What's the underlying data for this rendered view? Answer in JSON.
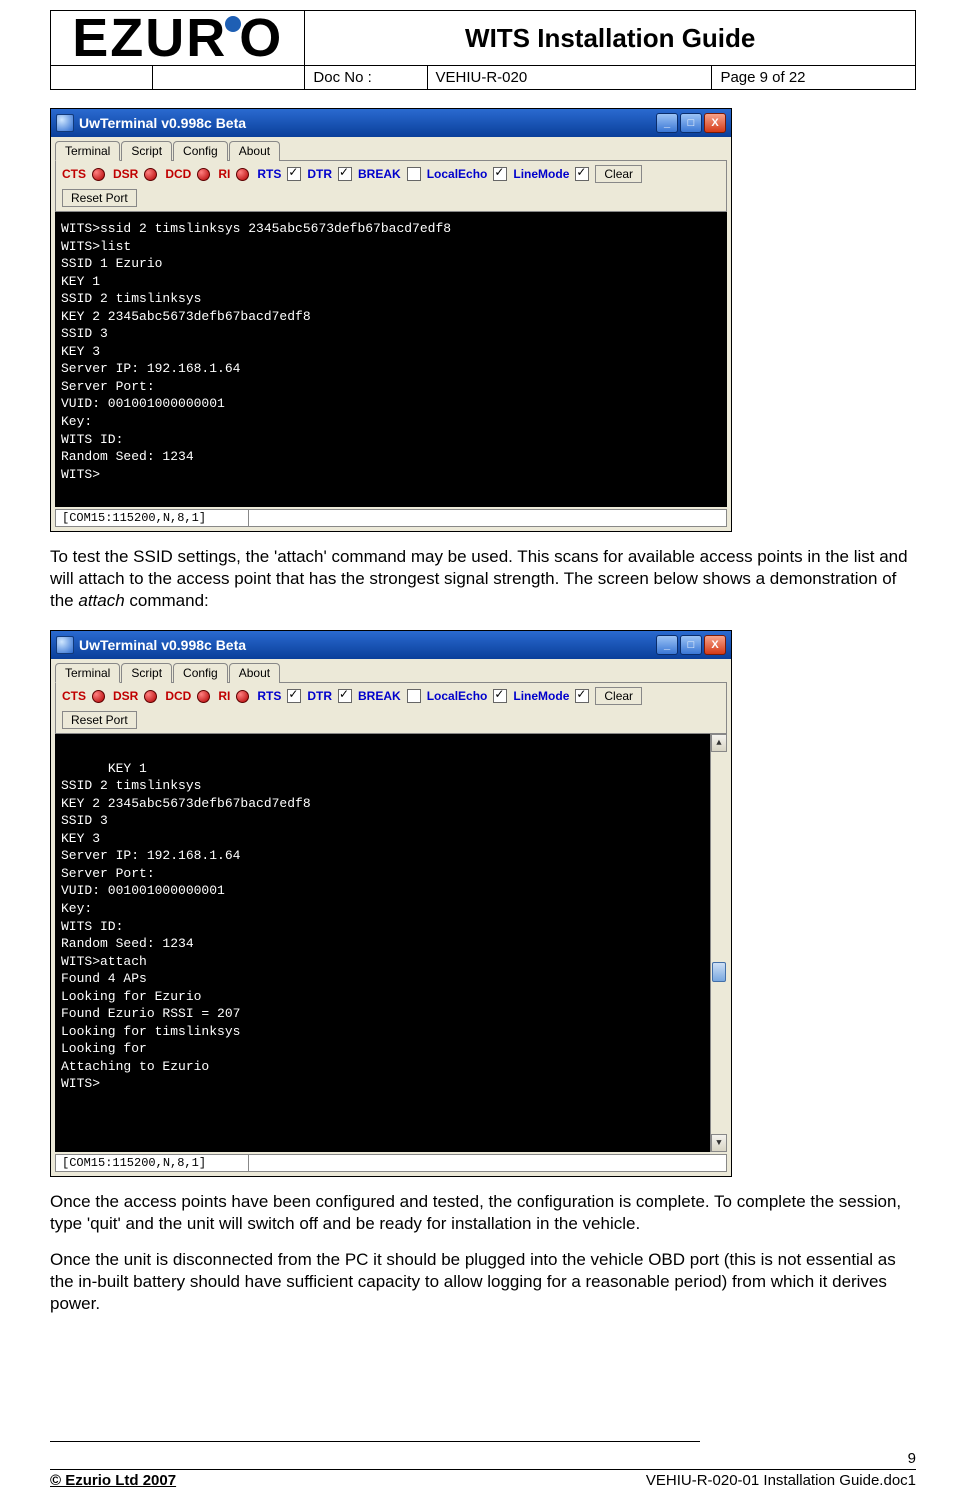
{
  "header": {
    "logo_text": "EZURiO",
    "title": "WITS Installation Guide",
    "doc_no_label": "Doc No :",
    "doc_no_value": "VEHIU-R-020",
    "page_info": "Page 9 of 22"
  },
  "terminal_common": {
    "window_title": "UwTerminal v0.998c Beta",
    "tabs": [
      "Terminal",
      "Script",
      "Config",
      "About"
    ],
    "leds": {
      "cts": "CTS",
      "dsr": "DSR",
      "dcd": "DCD",
      "ri": "RI",
      "rts": "RTS",
      "dtr": "DTR",
      "break": "BREAK",
      "localecho": "LocalEcho",
      "linemode": "LineMode"
    },
    "buttons": {
      "clear": "Clear",
      "reset": "Reset Port"
    },
    "status": "[COM15:115200,N,8,1]"
  },
  "terminal1_lines": [
    "WITS>ssid 2 timslinksys 2345abc5673defb67bacd7edf8",
    "WITS>list",
    "SSID 1 Ezurio",
    "KEY 1",
    "SSID 2 timslinksys",
    "KEY 2 2345abc5673defb67bacd7edf8",
    "SSID 3",
    "KEY 3",
    "Server IP: 192.168.1.64",
    "Server Port:",
    "VUID: 001001000000001",
    "Key:",
    "WITS ID:",
    "Random Seed: 1234",
    "WITS>"
  ],
  "para1": "To test the SSID settings, the 'attach' command may be used. This scans for available access points in the list and will attach to the access point that has the strongest signal strength. The screen below shows a demonstration of the ",
  "para1_em": "attach",
  "para1_tail": " command:",
  "terminal2_lines": [
    "KEY 1",
    "SSID 2 timslinksys",
    "KEY 2 2345abc5673defb67bacd7edf8",
    "SSID 3",
    "KEY 3",
    "Server IP: 192.168.1.64",
    "Server Port:",
    "VUID: 001001000000001",
    "Key:",
    "WITS ID:",
    "Random Seed: 1234",
    "WITS>attach",
    "Found 4 APs",
    "Looking for Ezurio",
    "Found Ezurio RSSI = 207",
    "Looking for timslinksys",
    "Looking for",
    "Attaching to Ezurio",
    "WITS>"
  ],
  "para2": "Once the access points have been configured and tested, the configuration is complete. To complete the session, type 'quit' and the unit will switch off and be ready for installation in the vehicle.",
  "para3": "Once the unit is disconnected from the PC it should be plugged into the vehicle OBD port (this is not essential as the in-built battery should have sufficient capacity to allow logging for a reasonable period) from which it derives power.",
  "footer": {
    "page_num": "9",
    "copyright": "© Ezurio Ltd 2007",
    "doc_file": "VEHIU-R-020-01 Installation Guide.doc1"
  }
}
